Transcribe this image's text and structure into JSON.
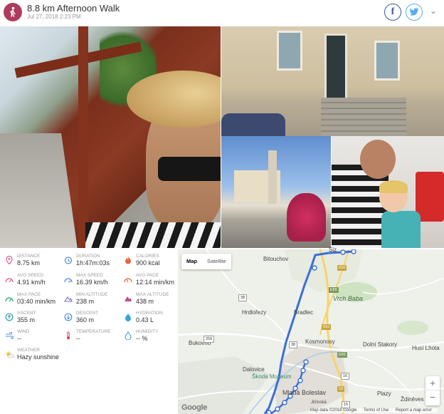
{
  "activity": {
    "title": "8.8 km Afternoon Walk",
    "date": "Jul 27, 2018 2:23 PM",
    "icon": "walking-person-icon",
    "icon_color": "#b03a5e"
  },
  "share": {
    "facebook_icon": "facebook-icon",
    "facebook_glyph": "f",
    "twitter_icon": "twitter-icon",
    "menu_icon": "chevron-down-icon"
  },
  "stats": {
    "distance": {
      "label": "DISTANCE",
      "value": "8.75 km",
      "color": "#e05a8a"
    },
    "duration": {
      "label": "DURATION",
      "value": "1h:47m:03s",
      "color": "#4a90d9"
    },
    "calories": {
      "label": "CALORIES",
      "value": "900 kcal",
      "color": "#e8663a"
    },
    "avg_speed": {
      "label": "AVG SPEED",
      "value": "4.91 km/h",
      "color": "#e05a8a"
    },
    "max_speed": {
      "label": "MAX SPEED",
      "value": "16.39 km/h",
      "color": "#4a90d9"
    },
    "avg_pace": {
      "label": "AVG PACE",
      "value": "12:14 min/km",
      "color": "#e8663a"
    },
    "max_pace": {
      "label": "MAX PACE",
      "value": "03:40 min/km",
      "color": "#2e9e6a"
    },
    "min_altitude": {
      "label": "MIN ALTITUDE",
      "value": "238 m",
      "color": "#7a6bc4"
    },
    "max_altitude": {
      "label": "MAX ALTITUDE",
      "value": "438 m",
      "color": "#c24a8a"
    },
    "ascent": {
      "label": "ASCENT",
      "value": "355 m",
      "color": "#2ea0a8"
    },
    "descent": {
      "label": "DESCENT",
      "value": "360 m",
      "color": "#4a90d9"
    },
    "hydration": {
      "label": "HYDRATION",
      "value": "0.43 L",
      "color": "#3aa3d9"
    },
    "wind": {
      "label": "WIND",
      "value": "--",
      "color": "#4a90d9"
    },
    "temperature": {
      "label": "TEMPERATURE",
      "value": "--",
      "color": "#c24a5a"
    },
    "humidity": {
      "label": "HUMIDITY",
      "value": "-- %",
      "color": "#3aa3d9"
    },
    "weather": {
      "label": "WEATHER",
      "value": "Hazy sunshine",
      "color": "#e8c23a"
    }
  },
  "map": {
    "map_label": "Map",
    "satellite_label": "Satellite",
    "zoom_in": "+",
    "zoom_out": "−",
    "logo": "Google",
    "attribution": {
      "data": "Map data ©2018 Google",
      "terms": "Terms of Use",
      "report": "Report a map error"
    },
    "route_color": "#3a6fd8",
    "places": {
      "bitouchov": "Bitouchov",
      "hrdlorezy": "Hrdlořezy",
      "bradlec": "Bradlec",
      "vrch_baba": "Vrch Baba",
      "bukovno": "Bukovno",
      "kosmonosy": "Kosmonosy",
      "dolni_stakory": "Dolní Stakory",
      "husi_lhota": "Husí Lhota",
      "dalovice": "Dalovice",
      "skoda_muzeum": "Škoda Muzeum",
      "mlada_boleslav": "Mladá Boleslav",
      "plazy": "Plazy",
      "zidneves": "Ždiněves",
      "jicinska": "Jičínská",
      "siz": "Siz"
    },
    "road_numbers": [
      "610",
      "E65",
      "38",
      "610",
      "38",
      "259",
      "E65",
      "10",
      "16",
      "15"
    ]
  }
}
